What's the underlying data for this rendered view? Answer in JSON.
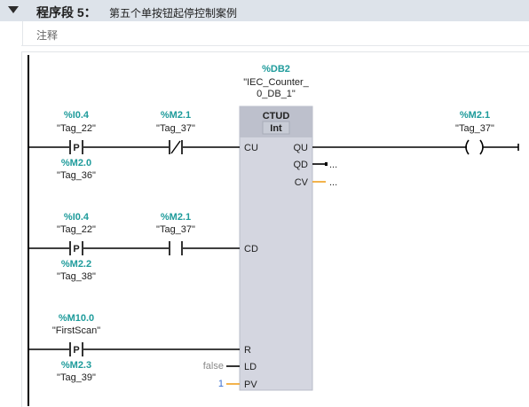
{
  "segment": {
    "label": "程序段 5：",
    "title": "第五个单按钮起停控制案例",
    "comment": "注释"
  },
  "block": {
    "db_address": "%DB2",
    "db_name_line1": "\"IEC_Counter_",
    "db_name_line2": "0_DB_1\"",
    "type": "CTUD",
    "data_type": "Int",
    "pins": {
      "cu": "CU",
      "cd": "CD",
      "r": "R",
      "ld": "LD",
      "pv": "PV",
      "qu": "QU",
      "qd": "QD",
      "cv": "CV"
    },
    "ld_value": "false",
    "pv_value": "1",
    "qd_value": "...",
    "cv_value": "..."
  },
  "contacts": [
    {
      "addr": "%I0.4",
      "name": "\"Tag_22\"",
      "kind": "P",
      "edge_addr": "%M2.0",
      "edge_name": "\"Tag_36\""
    },
    {
      "addr": "%M2.1",
      "name": "\"Tag_37\"",
      "kind": "NC"
    },
    {
      "addr": "%I0.4",
      "name": "\"Tag_22\"",
      "kind": "P",
      "edge_addr": "%M2.2",
      "edge_name": "\"Tag_38\""
    },
    {
      "addr": "%M2.1",
      "name": "\"Tag_37\"",
      "kind": "NO"
    },
    {
      "addr": "%M10.0",
      "name": "\"FirstScan\"",
      "kind": "P",
      "edge_addr": "%M2.3",
      "edge_name": "\"Tag_39\""
    }
  ],
  "coil": {
    "addr": "%M2.1",
    "name": "\"Tag_37\""
  },
  "colors": {
    "address": "#1e9b9b",
    "block_fill": "#d4d6e0",
    "block_header": "#bdc0cc",
    "pv_wire": "#f0a020"
  }
}
